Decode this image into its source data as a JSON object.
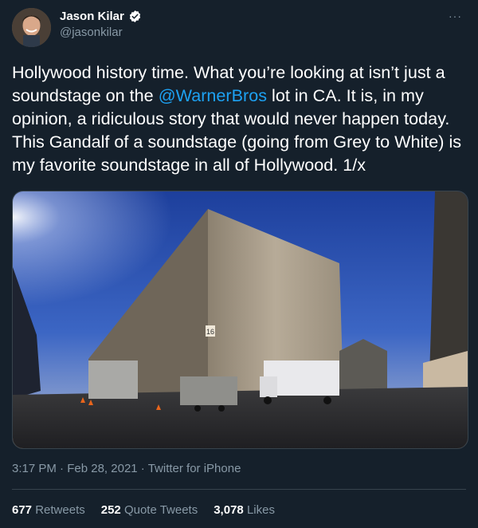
{
  "author": {
    "display_name": "Jason Kilar",
    "handle": "@jasonkilar",
    "verified_icon": "verified-badge-icon"
  },
  "menu": {
    "more_label": "···"
  },
  "tweet": {
    "part1": "Hollywood history time. What you’re looking at isn’t just a soundstage on the ",
    "mention": "@WarnerBros",
    "part2": " lot in CA. It is, in my opinion, a ridiculous story that would never happen today. This Gandalf of a soundstage (going from Grey to White) is my favorite soundstage in all of Hollywood. 1/x"
  },
  "media": {
    "stage_number": "16"
  },
  "meta": {
    "time": "3:17 PM",
    "sep1": " · ",
    "date": "Feb 28, 2021",
    "sep2": " · ",
    "source": "Twitter for iPhone"
  },
  "stats": [
    {
      "value": "677",
      "label": "Retweets"
    },
    {
      "value": "252",
      "label": "Quote Tweets"
    },
    {
      "value": "3,078",
      "label": "Likes"
    }
  ],
  "colors": {
    "background": "#15202b",
    "secondary_text": "#8899a6",
    "link": "#1da1f2",
    "divider": "#38444d"
  }
}
